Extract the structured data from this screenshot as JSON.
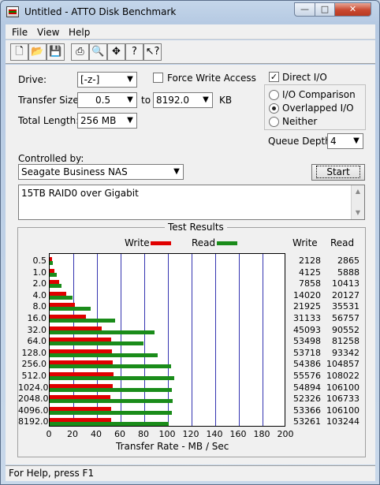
{
  "window": {
    "title": "Untitled - ATTO Disk Benchmark"
  },
  "menu": {
    "items": [
      {
        "label": "File"
      },
      {
        "label": "View"
      },
      {
        "label": "Help"
      }
    ]
  },
  "toolbar": {
    "icons": [
      "new-document-icon",
      "open-folder-icon",
      "save-disk-icon",
      "print-icon",
      "print-preview-icon",
      "move-icon",
      "help-icon",
      "context-help-icon"
    ]
  },
  "form": {
    "drive_label": "Drive:",
    "drive_value": "[-z-]",
    "force_write_label": "Force Write Access",
    "force_write_checked": false,
    "direct_io_label": "Direct I/O",
    "direct_io_checked": true,
    "transfer_size_label": "Transfer Size:",
    "transfer_from": "0.5",
    "to_label": "to",
    "transfer_to": "8192.0",
    "kb_label": "KB",
    "total_length_label": "Total Length:",
    "total_length_value": "256 MB",
    "io_modes": [
      {
        "label": "I/O Comparison",
        "checked": false
      },
      {
        "label": "Overlapped I/O",
        "checked": true
      },
      {
        "label": "Neither",
        "checked": false
      }
    ],
    "queue_depth_label": "Queue Depth:",
    "queue_depth_value": "4",
    "controlled_by_label": "Controlled by:",
    "controlled_by_value": "Seagate Business NAS",
    "start_button": "Start",
    "description": "15TB RAID0 over Gigabit"
  },
  "results": {
    "title": "Test Results",
    "legend_write": "Write",
    "legend_read": "Read",
    "col_write": "Write",
    "col_read": "Read",
    "write_color": "#e00000",
    "read_color": "#1a8c1a"
  },
  "chart_data": {
    "type": "bar",
    "orientation": "horizontal",
    "categories": [
      "0.5",
      "1.0",
      "2.0",
      "4.0",
      "8.0",
      "16.0",
      "32.0",
      "64.0",
      "128.0",
      "256.0",
      "512.0",
      "1024.0",
      "2048.0",
      "4096.0",
      "8192.0"
    ],
    "series": [
      {
        "name": "Write",
        "values": [
          2128,
          4125,
          7858,
          14020,
          21925,
          31133,
          45093,
          53498,
          53718,
          54386,
          55576,
          54894,
          52326,
          53366,
          53261
        ]
      },
      {
        "name": "Read",
        "values": [
          2865,
          5888,
          10413,
          20127,
          35531,
          56757,
          90552,
          81258,
          93342,
          104857,
          108022,
          106100,
          106733,
          106100,
          103244
        ]
      }
    ],
    "x_ticks": [
      "0",
      "20",
      "40",
      "60",
      "80",
      "100",
      "120",
      "140",
      "160",
      "180",
      "200"
    ],
    "xlim": [
      0,
      200
    ],
    "xlabel": "Transfer Rate - MB / Sec",
    "grid": true
  },
  "status": {
    "text": "For Help, press F1"
  }
}
